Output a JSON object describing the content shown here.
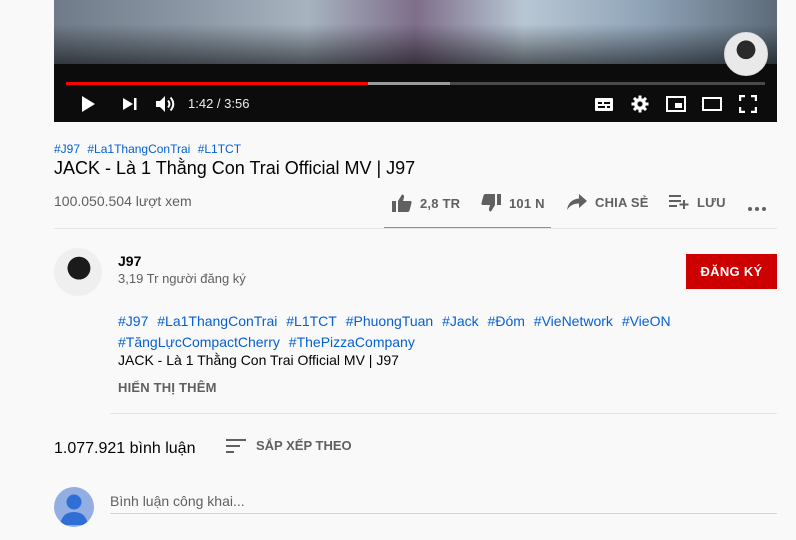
{
  "player": {
    "time_display": "1:42 / 3:56",
    "progress_fraction": 0.4322,
    "buffered_fraction": 0.55,
    "accent_color": "#ff0000",
    "controls": [
      "play-icon",
      "next-icon",
      "volume-icon",
      "subtitles-icon",
      "settings-icon",
      "miniplayer-icon",
      "theater-icon",
      "fullscreen-icon"
    ]
  },
  "video": {
    "hashtags": [
      "#J97",
      "#La1ThangConTrai",
      "#L1TCT"
    ],
    "title": "JACK - Là 1 Thằng Con Trai Official MV | J97",
    "views": "100.050.504 lượt xem"
  },
  "actions": {
    "like_count": "2,8 TR",
    "dislike_count": "101 N",
    "share_label": "CHIA SẺ",
    "save_label": "LƯU",
    "like_ratio": 0.965
  },
  "channel": {
    "name": "J97",
    "subscribers": "3,19 Tr người đăng ký",
    "subscribe_label": "ĐĂNG KÝ",
    "subscribe_color": "#cc0000"
  },
  "description": {
    "tags": [
      "#J97",
      "#La1ThangConTrai",
      "#L1TCT",
      "#PhuongTuan",
      "#Jack",
      "#Đóm",
      "#VieNetwork",
      "#VieON",
      "#TăngLựcCompactCherry",
      "#ThePizzaCompany"
    ],
    "text": "JACK - Là 1 Thằng Con Trai Official MV | J97",
    "show_more": "HIỂN THỊ THÊM"
  },
  "comments": {
    "count": "1.077.921 bình luận",
    "sort_label": "SẮP XẾP THEO",
    "input_placeholder": "Bình luận công khai..."
  },
  "link_color": "#065fd4"
}
